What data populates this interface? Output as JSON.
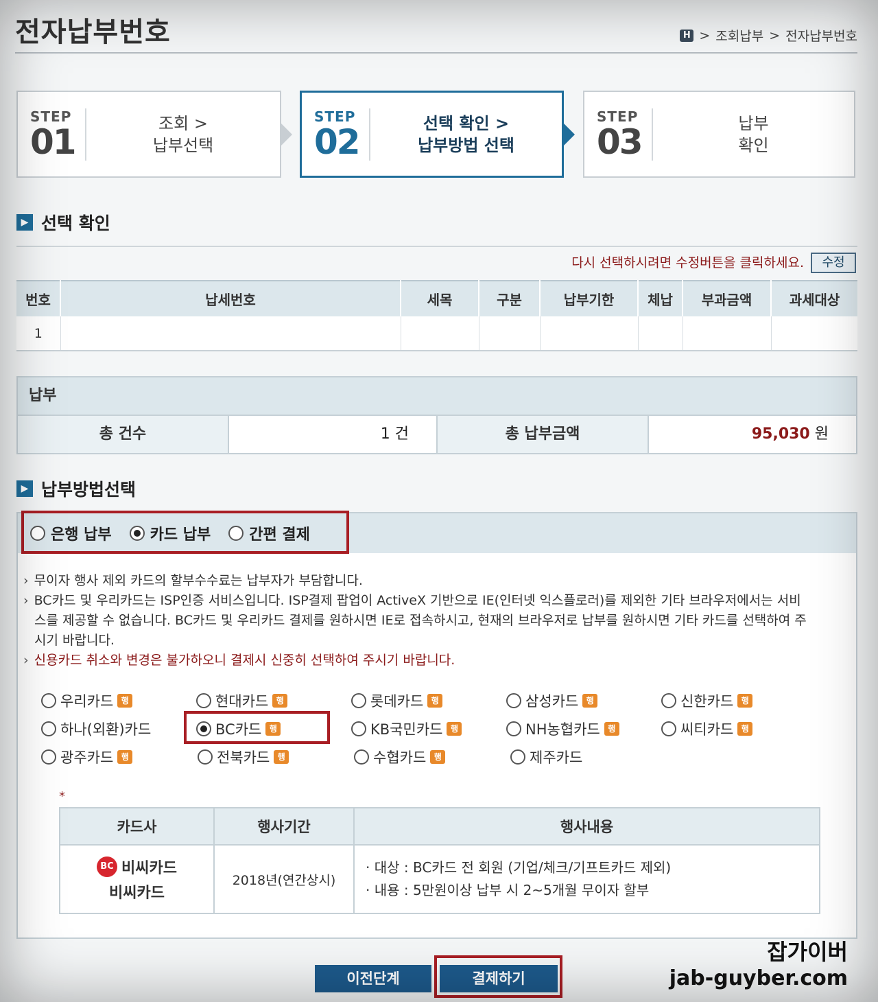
{
  "page": {
    "title": "전자납부번호",
    "breadcrumb": {
      "home_icon": "H",
      "sep": ">",
      "item1": "조회납부",
      "item2": "전자납부번호"
    }
  },
  "steps": [
    {
      "word": "STEP",
      "num": "01",
      "line1": "조회 >",
      "line2": "납부선택"
    },
    {
      "word": "STEP",
      "num": "02",
      "line1": "선택 확인 >",
      "line2": "납부방법 선택"
    },
    {
      "word": "STEP",
      "num": "03",
      "line1": "납부",
      "line2": "확인"
    }
  ],
  "selection": {
    "heading": "선택 확인",
    "notice": "다시 선택하시려면 수정버튼을 클릭하세요.",
    "edit_label": "수정",
    "columns": [
      "번호",
      "납세번호",
      "세목",
      "구분",
      "납부기한",
      "체납",
      "부과금액",
      "과세대상"
    ],
    "rows": [
      [
        "1",
        "",
        "",
        "",
        "",
        "",
        "",
        ""
      ]
    ]
  },
  "payment": {
    "heading": "납부",
    "count_label": "총 건수",
    "count_value": "1 건",
    "amount_label": "총 납부금액",
    "amount_number": "95,030",
    "amount_unit": "원"
  },
  "method": {
    "heading": "납부방법선택",
    "options": [
      "은행 납부",
      "카드 납부",
      "간편 결제"
    ],
    "selected": "카드 납부",
    "info": [
      "무이자 행사 제외 카드의 할부수수료는 납부자가 부담합니다.",
      "BC카드 및 우리카드는 ISP인증 서비스입니다. ISP결제 팝업이 ActiveX 기반으로 IE(인터넷 익스플로러)를 제외한 기타 브라우저에서는 서비스를 제공할 수 없습니다. BC카드 및 우리카드 결제를 원하시면 IE로 접속하시고, 현재의 브라우저로 납부를 원하시면 기타 카드를 선택하여 주시기 바랍니다.",
      "신용카드 취소와 변경은 불가하오니 결제시 신중히 선택하여 주시기 바랍니다."
    ],
    "badge_text": "행",
    "cards": [
      [
        {
          "name": "우리카드",
          "badge": true
        },
        {
          "name": "현대카드",
          "badge": true
        },
        {
          "name": "롯데카드",
          "badge": true
        },
        {
          "name": "삼성카드",
          "badge": true
        },
        {
          "name": "신한카드",
          "badge": true
        }
      ],
      [
        {
          "name": "하나(외환)카드",
          "badge": false
        },
        {
          "name": "BC카드",
          "badge": true,
          "selected": true
        },
        {
          "name": "KB국민카드",
          "badge": true
        },
        {
          "name": "NH농협카드",
          "badge": true
        },
        {
          "name": "씨티카드",
          "badge": true
        }
      ],
      [
        {
          "name": "광주카드",
          "badge": true
        },
        {
          "name": "전북카드",
          "badge": true
        },
        {
          "name": "수협카드",
          "badge": true
        },
        {
          "name": "제주카드",
          "badge": false
        }
      ]
    ]
  },
  "promo": {
    "asterisk": "*",
    "columns": [
      "카드사",
      "행사기간",
      "행사내용"
    ],
    "card_logo_mark": "BC",
    "card_logo_name": "비씨카드",
    "card_name": "비씨카드",
    "period": "2018년(연간상시)",
    "content": [
      "· 대상 : BC카드 전 회원 (기업/체크/기프트카드 제외)",
      "· 내용 : 5만원이상 납부 시 2~5개월 무이자 할부"
    ]
  },
  "buttons": {
    "prev": "이전단계",
    "pay": "결제하기"
  },
  "watermark": {
    "line1": "잡가이버",
    "line2": "jab-guyber.com"
  },
  "colors": {
    "accent": "#1f6d9a",
    "highlight_red": "#a81e24",
    "warning": "#8b1a1a",
    "button": "#1d5a8c"
  }
}
